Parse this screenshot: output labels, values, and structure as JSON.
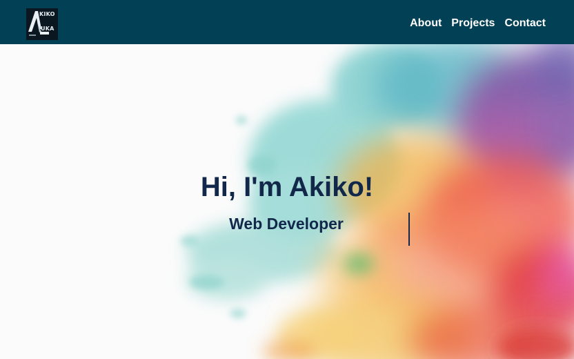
{
  "logo": {
    "line1": "KIKO",
    "line2": "UKA",
    "alt": "Akiko Uka logo"
  },
  "nav": {
    "items": [
      {
        "label": "About"
      },
      {
        "label": "Projects"
      },
      {
        "label": "Contact"
      }
    ]
  },
  "hero": {
    "title": "Hi, I'm Akiko!",
    "subtitle": "Web Developer"
  },
  "colors": {
    "navbar": "#024155",
    "heading": "#12284a",
    "background": "#fbfbfb"
  }
}
